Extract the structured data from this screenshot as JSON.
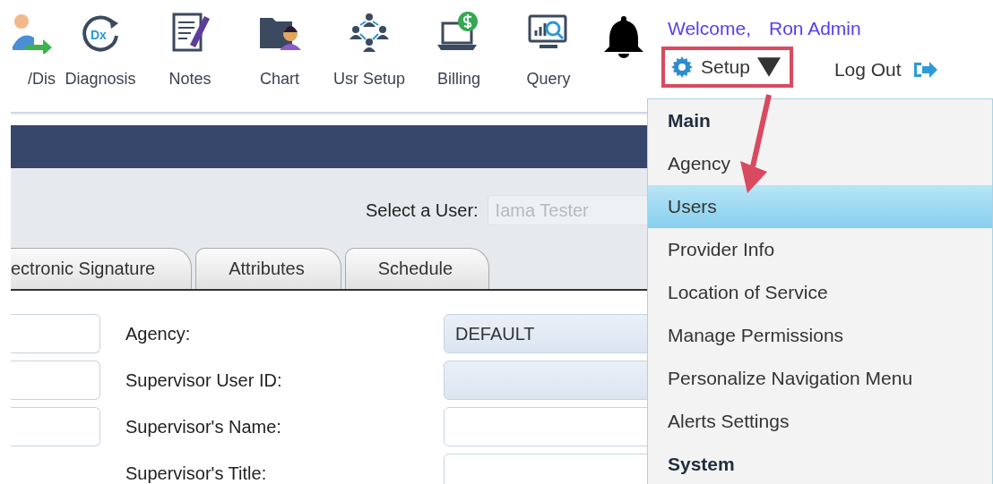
{
  "toolbar": [
    {
      "label": "/Dis"
    },
    {
      "label": "Diagnosis",
      "icon_text": "Dx"
    },
    {
      "label": "Notes"
    },
    {
      "label": "Chart"
    },
    {
      "label": "Usr Setup"
    },
    {
      "label": "Billing"
    },
    {
      "label": "Query"
    }
  ],
  "user": {
    "greeting": "Welcome,",
    "name": "Ron Admin",
    "setup": "Setup",
    "logout": "Log Out"
  },
  "select_user": {
    "label": "Select a User:",
    "placeholder": "Iama Tester"
  },
  "tabs": [
    {
      "label": "ectronic Signature",
      "selected": false
    },
    {
      "label": "Attributes",
      "selected": false
    },
    {
      "label": "Schedule",
      "selected": false
    }
  ],
  "form": [
    {
      "label": "Agency:",
      "kind": "select",
      "value": "DEFAULT",
      "left_field": true
    },
    {
      "label": "Supervisor User ID:",
      "kind": "select",
      "left_field": true
    },
    {
      "label": "Supervisor's Name:",
      "kind": "text",
      "left_field": true
    },
    {
      "label": "Supervisor's Title:",
      "kind": "text",
      "left_field": false
    }
  ],
  "setup_menu": [
    {
      "label": "Main",
      "kind": "header",
      "selected": false
    },
    {
      "label": "Agency",
      "kind": "item",
      "selected": false
    },
    {
      "label": "Users",
      "kind": "item",
      "selected": true
    },
    {
      "label": "Provider Info",
      "kind": "item",
      "selected": false
    },
    {
      "label": "Location of Service",
      "kind": "item",
      "selected": false
    },
    {
      "label": "Manage Permissions",
      "kind": "item",
      "selected": false
    },
    {
      "label": "Personalize Navigation Menu",
      "kind": "item",
      "selected": false
    },
    {
      "label": "Alerts Settings",
      "kind": "item",
      "selected": false
    },
    {
      "label": "System",
      "kind": "header",
      "selected": false
    }
  ]
}
